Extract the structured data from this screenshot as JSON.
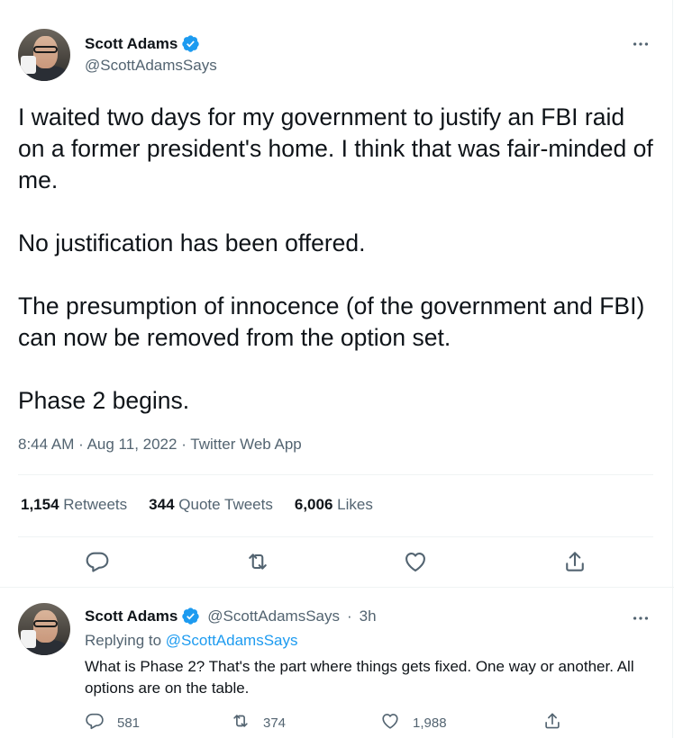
{
  "main_tweet": {
    "author_name": "Scott Adams",
    "handle": "@ScottAdamsSays",
    "paragraphs": [
      "I waited two days for my government to justify an FBI raid on a former president's home. I think that was fair-minded of me.",
      "No justification has been offered.",
      "The presumption of innocence (of the government and FBI) can now be removed from the option set.",
      "Phase 2 begins."
    ],
    "time": "8:44 AM",
    "date": "Aug 11, 2022",
    "source": "Twitter Web App",
    "stats": {
      "retweets_count": "1,154",
      "retweets_label": "Retweets",
      "quotes_count": "344",
      "quotes_label": "Quote Tweets",
      "likes_count": "6,006",
      "likes_label": "Likes"
    }
  },
  "reply": {
    "author_name": "Scott Adams",
    "handle": "@ScottAdamsSays",
    "age": "3h",
    "replying_prefix": "Replying to",
    "replying_handle": "@ScottAdamsSays",
    "text": "What is Phase 2? That's the part where things gets fixed. One way or another. All options are on the table.",
    "counts": {
      "replies": "581",
      "retweets": "374",
      "likes": "1,988"
    }
  },
  "colors": {
    "text_primary": "#0f1419",
    "text_secondary": "#536471",
    "verified_blue": "#1d9bf0",
    "divider": "#eff3f4"
  },
  "icons": {
    "reply": "reply-icon",
    "retweet": "retweet-icon",
    "like": "like-icon",
    "share": "share-icon",
    "verified": "verified-badge-icon",
    "more": "more-icon"
  }
}
